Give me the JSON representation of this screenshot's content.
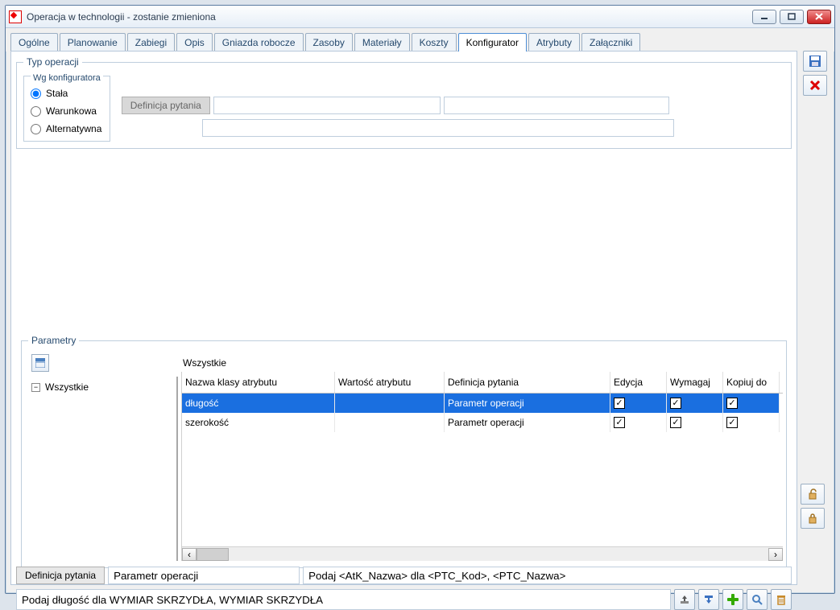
{
  "window": {
    "title": "Operacja w technologii - zostanie zmieniona"
  },
  "tabs": [
    "Ogólne",
    "Planowanie",
    "Zabiegi",
    "Opis",
    "Gniazda robocze",
    "Zasoby",
    "Materiały",
    "Koszty",
    "Konfigurator",
    "Atrybuty",
    "Załączniki"
  ],
  "active_tab": "Konfigurator",
  "typ_operacji": {
    "legend": "Typ operacji",
    "wg_konfiguratora": "Wg konfiguratora",
    "options": {
      "stala": "Stała",
      "warunkowa": "Warunkowa",
      "alternatywna": "Alternatywna"
    },
    "selected": "stala",
    "definicja_label": "Definicja pytania"
  },
  "parametry": {
    "legend": "Parametry",
    "all_label": "Wszystkie",
    "tree_root": "Wszystkie",
    "columns": {
      "nazwa": "Nazwa klasy atrybutu",
      "wartosc": "Wartość atrybutu",
      "definicja": "Definicja pytania",
      "edycja": "Edycja",
      "wymagaj": "Wymagaj",
      "kopiuj": "Kopiuj do"
    },
    "rows": [
      {
        "nazwa": "długość",
        "wartosc": "",
        "definicja": "Parametr operacji",
        "edycja": true,
        "wymagaj": true,
        "kopiuj": true,
        "selected": true
      },
      {
        "nazwa": "szerokość",
        "wartosc": "",
        "definicja": "Parametr operacji",
        "edycja": true,
        "wymagaj": true,
        "kopiuj": true,
        "selected": false
      }
    ]
  },
  "def_pytania": {
    "label": "Definicja pytania",
    "value1": "Parametr operacji",
    "value2": "Podaj <AtK_Nazwa> dla <PTC_Kod>, <PTC_Nazwa>"
  },
  "bottom_value": "Podaj długość dla WYMIAR SKRZYDŁA, WYMIAR SKRZYDŁA",
  "icons": {
    "save": "save",
    "close": "close",
    "lock": "lock",
    "unlock": "unlock",
    "upload": "upload",
    "download": "download",
    "plus": "plus",
    "search": "search",
    "trash": "trash"
  }
}
